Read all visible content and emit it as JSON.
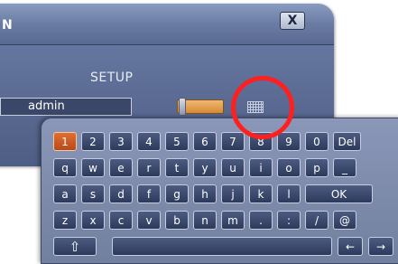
{
  "dialog": {
    "title": "N",
    "close_label": "X",
    "heading": "SETUP",
    "user_value": "admin"
  },
  "keyboard": {
    "rows": [
      [
        {
          "label": "1",
          "active": true
        },
        {
          "label": "2"
        },
        {
          "label": "3"
        },
        {
          "label": "4"
        },
        {
          "label": "5"
        },
        {
          "label": "6"
        },
        {
          "label": "7"
        },
        {
          "label": "8"
        },
        {
          "label": "9"
        },
        {
          "label": "0"
        },
        {
          "label": "Del"
        }
      ],
      [
        {
          "label": "q"
        },
        {
          "label": "w"
        },
        {
          "label": "e"
        },
        {
          "label": "r"
        },
        {
          "label": "t"
        },
        {
          "label": "y"
        },
        {
          "label": "u"
        },
        {
          "label": "i"
        },
        {
          "label": "o"
        },
        {
          "label": "p"
        },
        {
          "label": "_"
        }
      ],
      [
        {
          "label": "a"
        },
        {
          "label": "s"
        },
        {
          "label": "d"
        },
        {
          "label": "f"
        },
        {
          "label": "g"
        },
        {
          "label": "h"
        },
        {
          "label": "j"
        },
        {
          "label": "k"
        },
        {
          "label": "l"
        },
        {
          "label": "OK"
        }
      ],
      [
        {
          "label": "z"
        },
        {
          "label": "x"
        },
        {
          "label": "c"
        },
        {
          "label": "v"
        },
        {
          "label": "b"
        },
        {
          "label": "n"
        },
        {
          "label": "m"
        },
        {
          "label": "."
        },
        {
          "label": ":"
        },
        {
          "label": "/"
        },
        {
          "label": "@"
        }
      ],
      [
        {
          "label": "⇧",
          "icon": "shift-icon"
        },
        {
          "label": "",
          "icon": "space"
        },
        {
          "label": "←",
          "icon": "left-arrow-icon"
        },
        {
          "label": "→",
          "icon": "right-arrow-icon"
        }
      ]
    ]
  },
  "colors": {
    "active_key": "#e0702e",
    "highlight_ring": "#ff1f1f",
    "panel": "#8a97b8"
  }
}
